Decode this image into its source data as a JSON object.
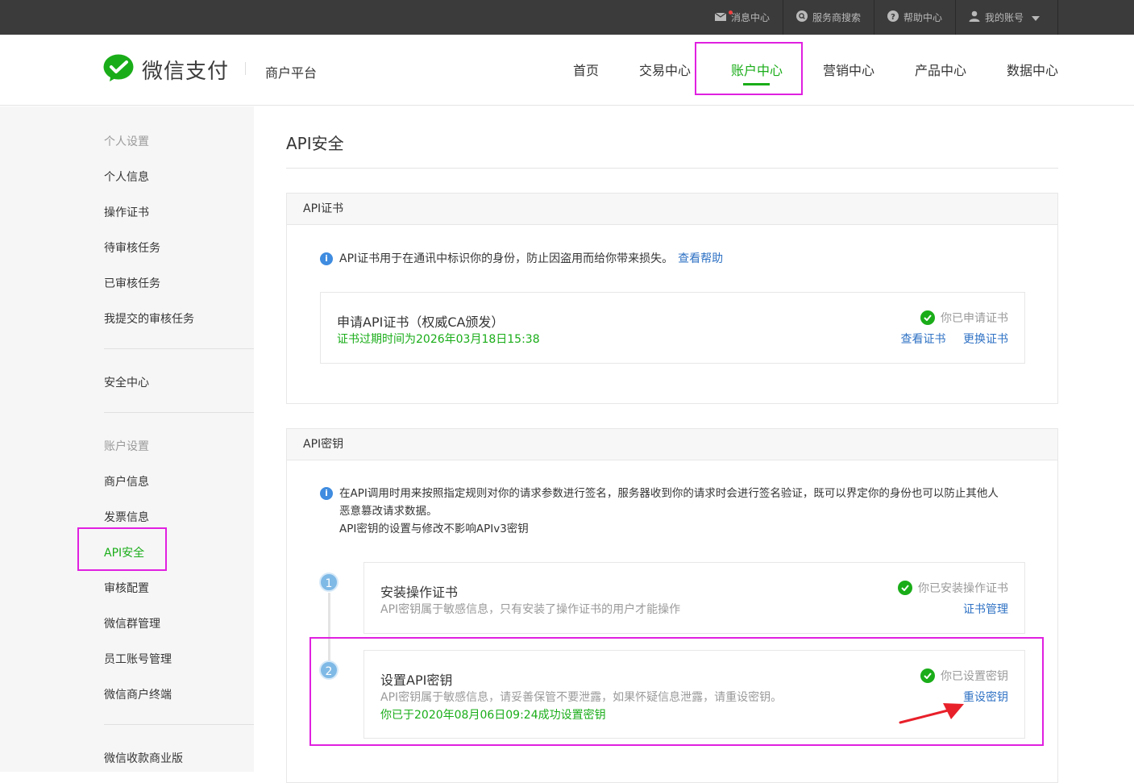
{
  "topbar": {
    "items": [
      {
        "icon": "mail-icon",
        "label": "消息中心"
      },
      {
        "icon": "search-circle-icon",
        "label": "服务商搜索"
      },
      {
        "icon": "help-icon",
        "label": "帮助中心"
      },
      {
        "icon": "user-icon",
        "label": "我的账号"
      }
    ]
  },
  "header": {
    "brand": "微信支付",
    "subtitle": "商户平台",
    "nav": [
      "首页",
      "交易中心",
      "账户中心",
      "营销中心",
      "产品中心",
      "数据中心"
    ],
    "active_nav": "账户中心"
  },
  "sidebar": {
    "group_personal": "个人设置",
    "personal_items": [
      "个人信息",
      "操作证书",
      "待审核任务",
      "已审核任务",
      "我提交的审核任务"
    ],
    "security": "安全中心",
    "group_account": "账户设置",
    "account_items": [
      "商户信息",
      "发票信息",
      "API安全",
      "审核配置",
      "微信群管理",
      "员工账号管理",
      "微信商户终端"
    ],
    "bottom_item": "微信收款商业版",
    "active_item": "API安全"
  },
  "page": {
    "title": "API安全"
  },
  "cert_panel": {
    "title": "API证书",
    "info_text": "API证书用于在通讯中标识你的身份，防止因盗用而给你带来损失。",
    "info_link": "查看帮助",
    "box_title": "申请API证书（权威CA颁发）",
    "expiry": "证书过期时间为2026年03月18日15:38",
    "status": "你已申请证书",
    "link_view": "查看证书",
    "link_replace": "更换证书"
  },
  "key_panel": {
    "title": "API密钥",
    "info_line1": "在API调用时用来按照指定规则对你的请求参数进行签名，服务器收到你的请求时会进行签名验证，既可以界定你的身份也可以防止其他人",
    "info_line2": "恶意篡改请求数据。",
    "info_line3": "API密钥的设置与修改不影响APIv3密钥",
    "step1": {
      "num": "1",
      "title": "安装操作证书",
      "desc": "API密钥属于敏感信息，只有安装了操作证书的用户才能操作",
      "status": "你已安装操作证书",
      "link": "证书管理"
    },
    "step2": {
      "num": "2",
      "title": "设置API密钥",
      "desc": "API密钥属于敏感信息，请妥善保管不要泄露，如果怀疑信息泄露，请重设密钥。",
      "set_time": "你已于2020年08月06日09:24成功设置密钥",
      "status": "你已设置密钥",
      "link": "重设密钥"
    }
  },
  "colors": {
    "brand_green": "#1aad19",
    "link_blue": "#2f72c4",
    "highlight": "#e020e0",
    "arrow": "#e8202a"
  }
}
